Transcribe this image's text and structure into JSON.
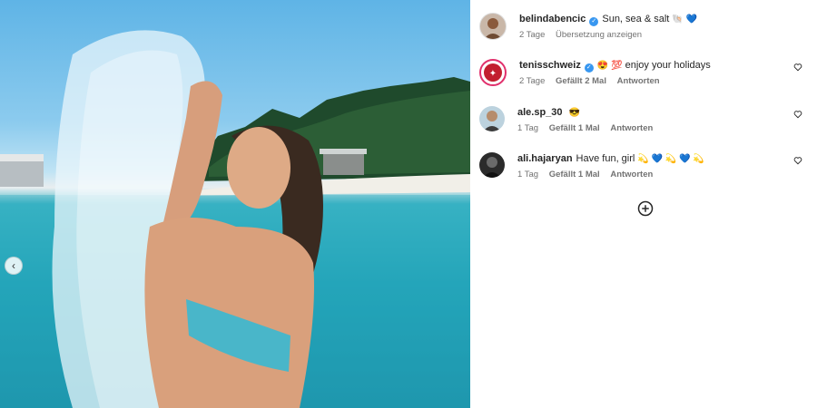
{
  "post": {
    "author": "belindabencic",
    "caption": "Sun, sea & salt",
    "caption_emoji": "🐚 💙",
    "time": "2 Tage",
    "translate": "Übersetzung anzeigen"
  },
  "comments": [
    {
      "user": "tenisschweiz",
      "verified": true,
      "emoji": "😍 💯",
      "text": "enjoy your holidays",
      "time": "2 Tage",
      "likes": "Gefällt 2 Mal",
      "reply": "Antworten"
    },
    {
      "user": "ale.sp_30",
      "verified": false,
      "emoji": "😎",
      "text": "",
      "time": "1 Tag",
      "likes": "Gefällt 1 Mal",
      "reply": "Antworten"
    },
    {
      "user": "ali.hajaryan",
      "verified": false,
      "emoji": "💫 💙 💫 💙 💫",
      "text": "Have fun, girl",
      "time": "1 Tag",
      "likes": "Gefällt 1 Mal",
      "reply": "Antworten"
    }
  ],
  "icons": {
    "verified": "✓",
    "heart": "heart-icon",
    "more": "plus-circle-icon",
    "prev": "‹"
  },
  "colors": {
    "verified": "#3897f0",
    "meta": "#737373",
    "text": "#262626"
  }
}
